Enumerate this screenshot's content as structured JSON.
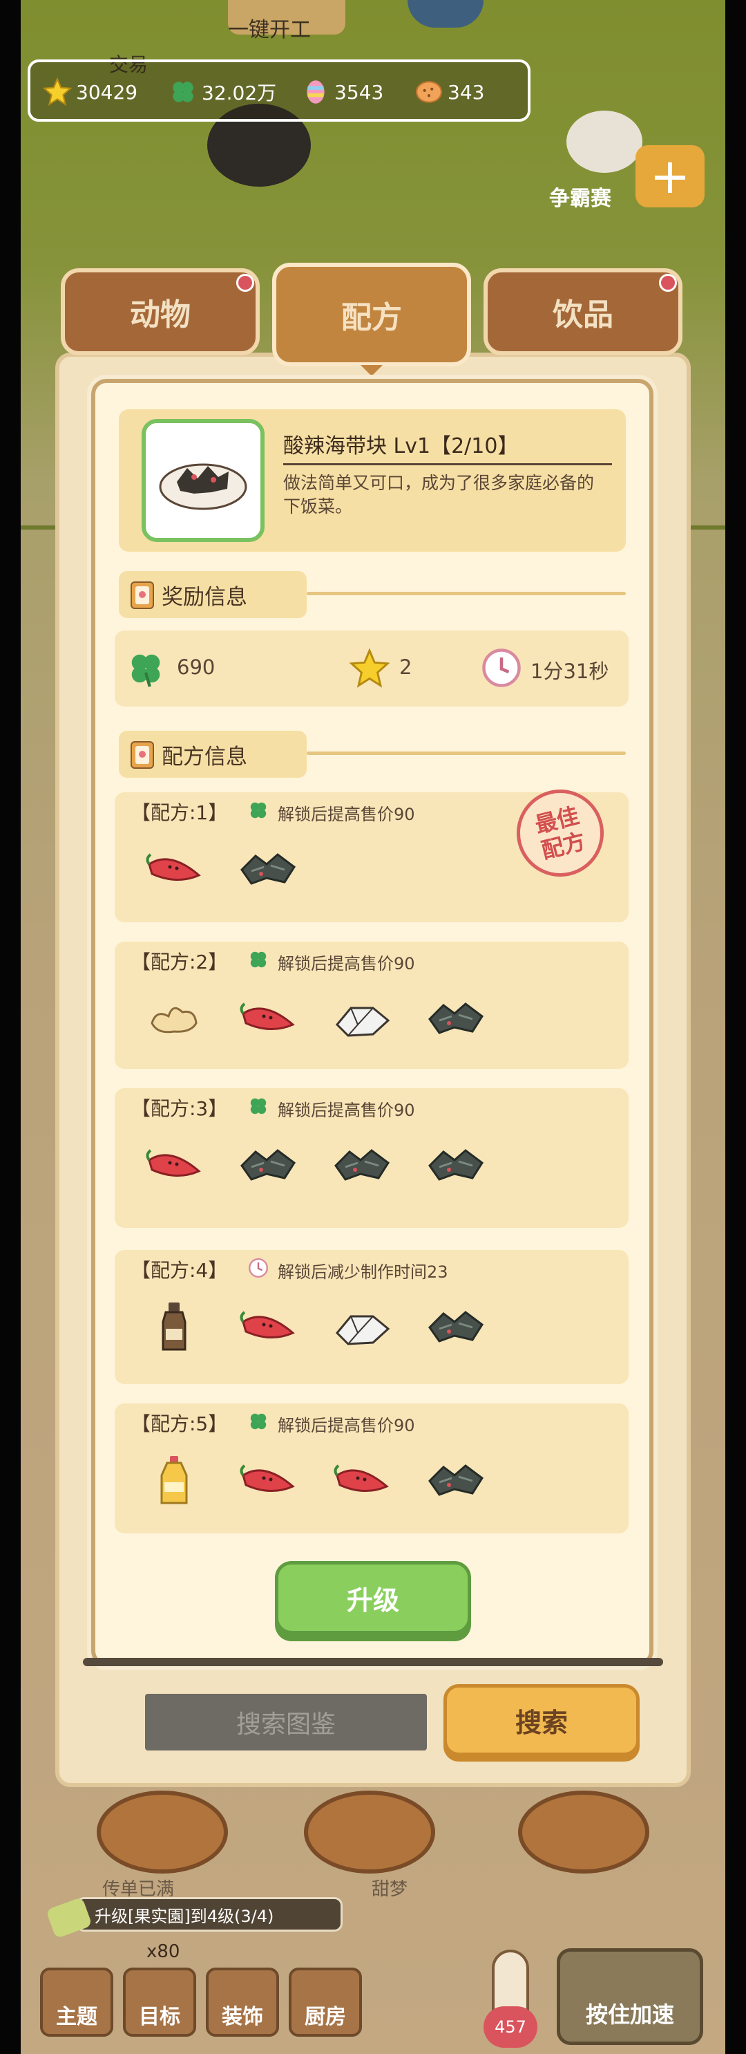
{
  "top_button": "一键开工",
  "trade_label": "交易",
  "contest_label": "争霸赛",
  "currencies": [
    {
      "icon": "star-icon",
      "value": "30429"
    },
    {
      "icon": "clover-icon",
      "value": "32.02万"
    },
    {
      "icon": "candy-icon",
      "value": "3543"
    },
    {
      "icon": "cookie-icon",
      "value": "343"
    }
  ],
  "tabs": {
    "animals": "动物",
    "recipes": "配方",
    "drinks": "饮品"
  },
  "dish": {
    "title": "酸辣海带块 Lv1【2/10】",
    "desc": "做法简单又可口，成为了很多家庭必备的下饭菜。"
  },
  "reward_section": "奖励信息",
  "rewards": {
    "clover": "690",
    "stars": "2",
    "time": "1分31秒"
  },
  "recipe_section": "配方信息",
  "best_stamp": "最佳配方",
  "recipes": [
    {
      "title": "【配方:1】",
      "note_icon": "clover-icon",
      "note": "解锁后提高售价90",
      "ingredients": [
        "chili",
        "seaweed"
      ]
    },
    {
      "title": "【配方:2】",
      "note_icon": "clover-icon",
      "note": "解锁后提高售价90",
      "ingredients": [
        "ginger",
        "chili",
        "tofu",
        "seaweed"
      ]
    },
    {
      "title": "【配方:3】",
      "note_icon": "clover-icon",
      "note": "解锁后提高售价90",
      "ingredients": [
        "chili",
        "seaweed",
        "seaweed",
        "seaweed"
      ]
    },
    {
      "title": "【配方:4】",
      "note_icon": "clock-icon",
      "note": "解锁后减少制作时间23",
      "ingredients": [
        "soy-sauce",
        "chili",
        "tofu",
        "seaweed"
      ]
    },
    {
      "title": "【配方:5】",
      "note_icon": "clover-icon",
      "note": "解锁后提高售价90",
      "ingredients": [
        "oil",
        "chili",
        "chili",
        "seaweed"
      ]
    }
  ],
  "upgrade_button": "升级",
  "search_placeholder": "搜索图鉴",
  "search_button": "搜索",
  "task": {
    "text": "升级[果实園]到4级(3/4)",
    "count": "x80"
  },
  "shop_labels": [
    "传单已满",
    "甜梦"
  ],
  "temp_value": "457",
  "bottom_nav": [
    "主题",
    "目标",
    "装饰",
    "厨房"
  ],
  "speed_button": "按住加速",
  "colors": {
    "panel": "#f2e2bf",
    "card": "#fff5dc",
    "tab": "#a46838",
    "upgrade": "#8acf5e",
    "search": "#f1b94f"
  }
}
